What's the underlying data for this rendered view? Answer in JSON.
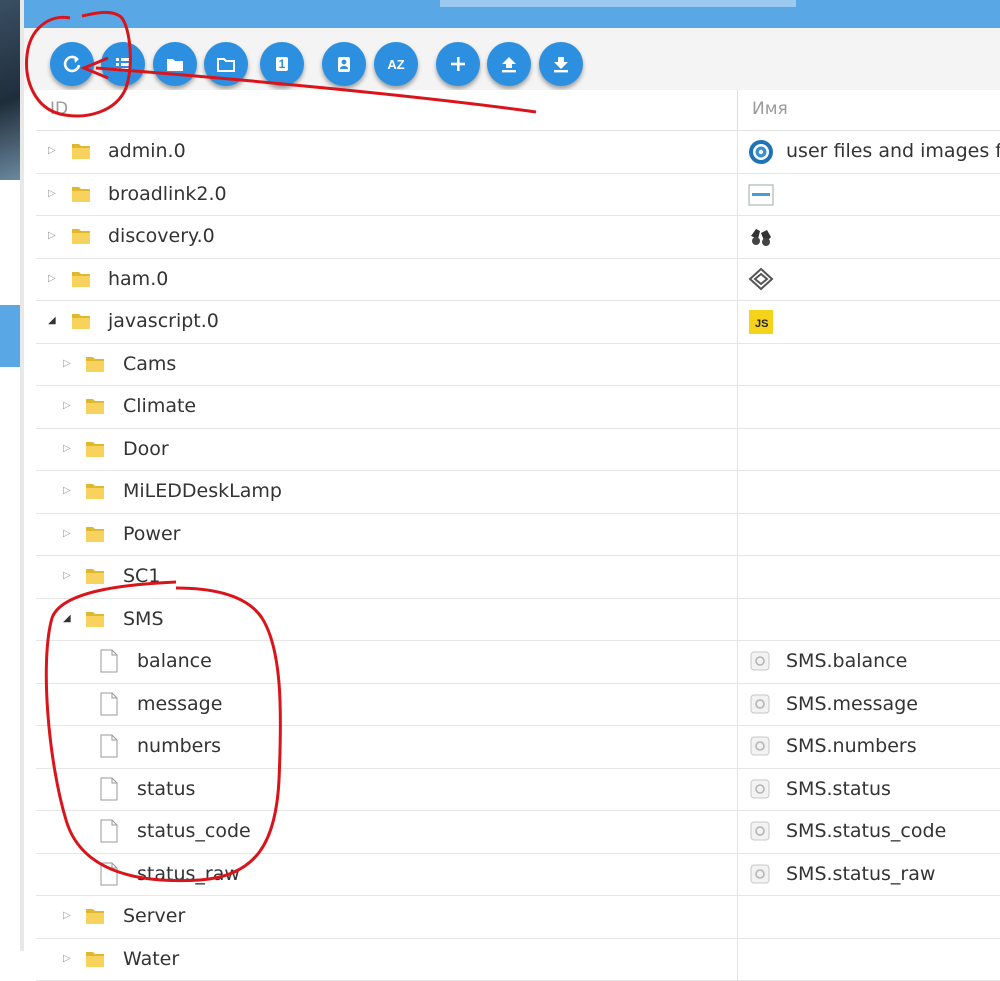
{
  "toolbar": {
    "buttons": [
      {
        "name": "refresh-button",
        "icon": "refresh-icon"
      },
      {
        "name": "list-view-button",
        "icon": "list-icon"
      },
      {
        "name": "collapse-folders-button",
        "icon": "folder-icon"
      },
      {
        "name": "expand-folders-button",
        "icon": "folder-open-icon"
      },
      {
        "name": "counter-button",
        "icon": "one-icon",
        "label": "1"
      },
      {
        "name": "edit-button",
        "icon": "clipboard-user-icon"
      },
      {
        "name": "sort-az-button",
        "icon": "sort-az-icon",
        "label": "AZ"
      },
      {
        "name": "add-button",
        "icon": "plus-icon"
      },
      {
        "name": "upload-button",
        "icon": "upload-icon"
      },
      {
        "name": "download-button",
        "icon": "download-icon"
      }
    ]
  },
  "header": {
    "id_col": "ID",
    "name_col": "Имя"
  },
  "rows": [
    {
      "level": 0,
      "type": "folder",
      "expanded": false,
      "label": "admin.0",
      "name": "user files and images fo",
      "icon": "admin-gear-icon"
    },
    {
      "level": 0,
      "type": "folder",
      "expanded": false,
      "label": "broadlink2.0",
      "name": "",
      "icon": "broadlink-logo-icon"
    },
    {
      "level": 0,
      "type": "folder",
      "expanded": false,
      "label": "discovery.0",
      "name": "",
      "icon": "binoculars-icon"
    },
    {
      "level": 0,
      "type": "folder",
      "expanded": false,
      "label": "ham.0",
      "name": "",
      "icon": "homebridge-icon"
    },
    {
      "level": 0,
      "type": "folder",
      "expanded": true,
      "label": "javascript.0",
      "name": "",
      "icon": "js-icon"
    },
    {
      "level": 1,
      "type": "folder",
      "expanded": false,
      "label": "Cams",
      "name": ""
    },
    {
      "level": 1,
      "type": "folder",
      "expanded": false,
      "label": "Climate",
      "name": ""
    },
    {
      "level": 1,
      "type": "folder",
      "expanded": false,
      "label": "Door",
      "name": ""
    },
    {
      "level": 1,
      "type": "folder",
      "expanded": false,
      "label": "MiLEDDeskLamp",
      "name": ""
    },
    {
      "level": 1,
      "type": "folder",
      "expanded": false,
      "label": "Power",
      "name": ""
    },
    {
      "level": 1,
      "type": "folder",
      "expanded": false,
      "label": "SC1",
      "name": ""
    },
    {
      "level": 1,
      "type": "folder",
      "expanded": true,
      "label": "SMS",
      "name": ""
    },
    {
      "level": 2,
      "type": "state",
      "label": "balance",
      "name": "SMS.balance"
    },
    {
      "level": 2,
      "type": "state",
      "label": "message",
      "name": "SMS.message"
    },
    {
      "level": 2,
      "type": "state",
      "label": "numbers",
      "name": "SMS.numbers"
    },
    {
      "level": 2,
      "type": "state",
      "label": "status",
      "name": "SMS.status"
    },
    {
      "level": 2,
      "type": "state",
      "label": "status_code",
      "name": "SMS.status_code"
    },
    {
      "level": 2,
      "type": "state",
      "label": "status_raw",
      "name": "SMS.status_raw"
    },
    {
      "level": 1,
      "type": "folder",
      "expanded": false,
      "label": "Server",
      "name": ""
    },
    {
      "level": 1,
      "type": "folder",
      "expanded": false,
      "label": "Water",
      "name": ""
    }
  ],
  "annotation_color": "#d9141b",
  "accent_color": "#2d8fe0"
}
